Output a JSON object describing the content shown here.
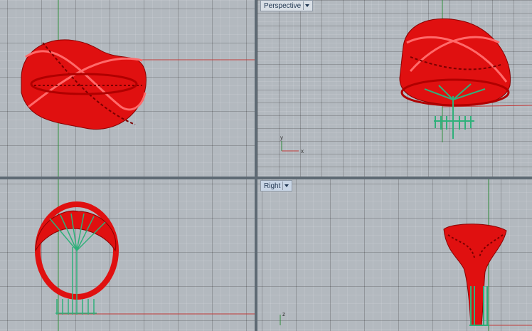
{
  "viewports": {
    "top": {
      "label": ""
    },
    "perspective": {
      "label": "Perspective"
    },
    "front": {
      "label": ""
    },
    "right": {
      "label": "Right"
    }
  },
  "axes": {
    "perspective": {
      "x": "x",
      "y": "y"
    },
    "right": {
      "z": "z"
    }
  },
  "colors": {
    "model": "#e01010",
    "support": "#2fb07a",
    "axis_x": "#c23a3a",
    "axis_y": "#2e8b3a",
    "grid_bg": "#b3b9bf",
    "divider": "#5e6a74"
  },
  "icons": {
    "dropdown": "chevron-down-icon",
    "axis_widget": "axis-icon"
  }
}
